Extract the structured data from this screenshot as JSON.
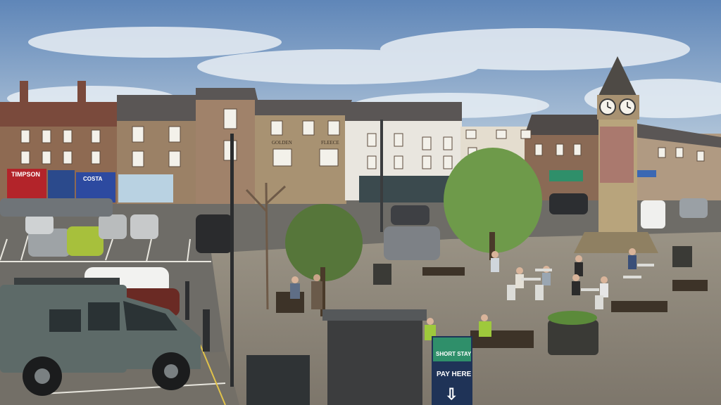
{
  "scene": {
    "colors": {
      "sky_top": "#5f86b8",
      "sky_bottom": "#c9d6e3",
      "brick": "#8e6a52",
      "stone": "#a89272",
      "white_building": "#e9e6df",
      "roof": "#5a5655",
      "road": "#6b6a66",
      "paving": "#8b8478",
      "tree": "#6e9a4a",
      "land_rover": "#5d6a68",
      "sign_green": "#2f8f6a",
      "sign_navy": "#1f3357"
    },
    "signs": {
      "timpson": "TIMPSON",
      "costa": "COSTA",
      "golden": "GOLDEN",
      "fleece": "FLEECE",
      "short_stay": "SHORT STAY",
      "pay_here": "PAY HERE",
      "arrow": "⇩"
    },
    "icons": {
      "clock": "clock-icon"
    }
  }
}
